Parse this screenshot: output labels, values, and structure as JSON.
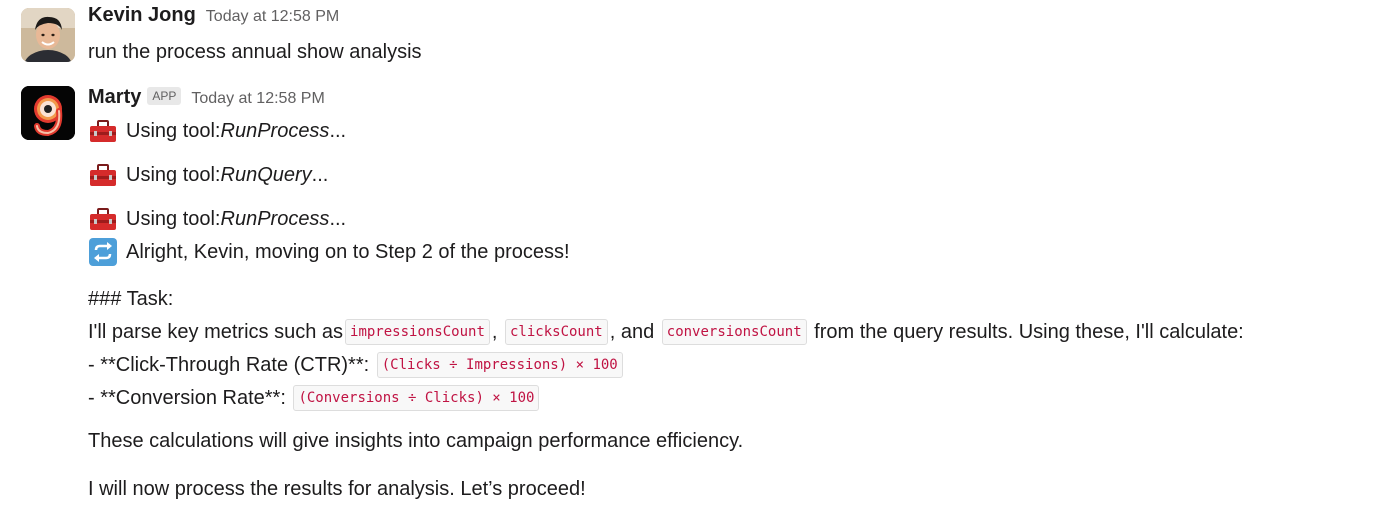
{
  "messages": [
    {
      "author": "Kevin Jong",
      "time": "Today at 12:58 PM",
      "text": "run the process annual show analysis"
    },
    {
      "author": "Marty",
      "badge": "APP",
      "time": "Today at 12:58 PM",
      "tool_calls": [
        {
          "prefix": "Using tool: ",
          "tool": "RunProcess",
          "suffix": "..."
        },
        {
          "prefix": "Using tool: ",
          "tool": "RunQuery",
          "suffix": "..."
        },
        {
          "prefix": "Using tool: ",
          "tool": "RunProcess",
          "suffix": "..."
        }
      ],
      "status_line": "Alright, Kevin, moving on to Step 2 of the process!",
      "task_heading": "### Task:",
      "parse_line": {
        "before": "I'll parse key metrics such as ",
        "metric1": "impressionsCount",
        "sep1": ", ",
        "metric2": "clicksCount",
        "sep2": ", and ",
        "metric3": "conversionsCount",
        "after": " from the query results. Using these, I'll calculate:"
      },
      "bullets": [
        {
          "label": "- **Click-Through Rate (CTR)**: ",
          "formula": "(Clicks ÷ Impressions) × 100"
        },
        {
          "label": "- **Conversion Rate**: ",
          "formula": "(Conversions ÷ Clicks) × 100"
        }
      ],
      "insight_line": "These calculations will give insights into campaign performance efficiency.",
      "closing_line": "I will now process the results for analysis. Let’s proceed!"
    }
  ],
  "icons": {
    "toolbox": "toolbox-icon",
    "repeat": "repeat-arrows-icon"
  },
  "colors": {
    "code_text": "#c01343",
    "muted": "#616061",
    "text": "#1d1c1d"
  }
}
